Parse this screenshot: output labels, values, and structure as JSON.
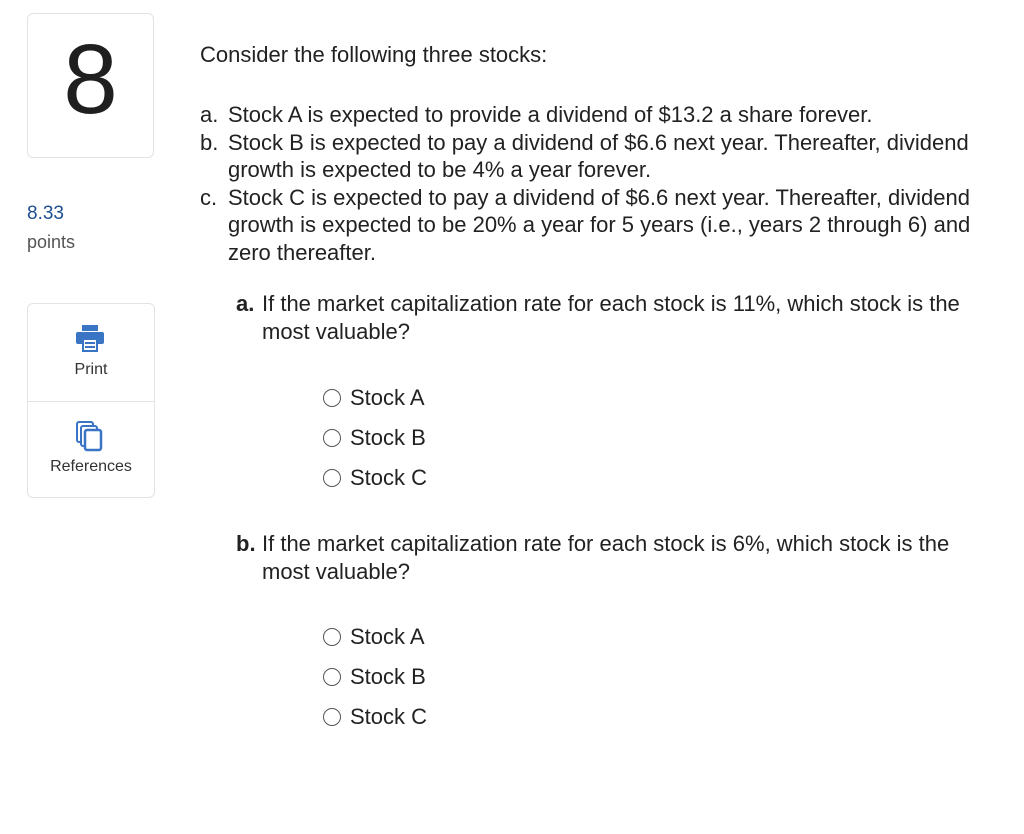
{
  "question_number": "8",
  "points": {
    "value": "8.33",
    "label": "points"
  },
  "tools": [
    {
      "label": "Print",
      "icon": "print-icon"
    },
    {
      "label": "References",
      "icon": "references-icon"
    }
  ],
  "colors": {
    "points": "#1d4f91",
    "icon": "#3a74c4"
  },
  "intro": "Consider the following three stocks:",
  "stocks": [
    {
      "letter": "a.",
      "text": "Stock A is expected to provide a dividend of $13.2 a share forever."
    },
    {
      "letter": "b.",
      "text": "Stock B is expected to pay a dividend of $6.6 next year. Thereafter, dividend growth is expected to be 4% a year forever."
    },
    {
      "letter": "c.",
      "text": "Stock C is expected to pay a dividend of $6.6 next year. Thereafter, dividend growth is expected to be 20% a year for 5 years (i.e., years 2 through 6) and zero thereafter."
    }
  ],
  "questions": [
    {
      "letter": "a.",
      "text": "If the market capitalization rate for each stock is 11%, which stock is the most valuable?",
      "options": [
        "Stock A",
        "Stock B",
        "Stock C"
      ]
    },
    {
      "letter": "b.",
      "text": "If the market capitalization rate for each stock is 6%, which stock is the most valuable?",
      "options": [
        "Stock A",
        "Stock B",
        "Stock C"
      ]
    }
  ]
}
